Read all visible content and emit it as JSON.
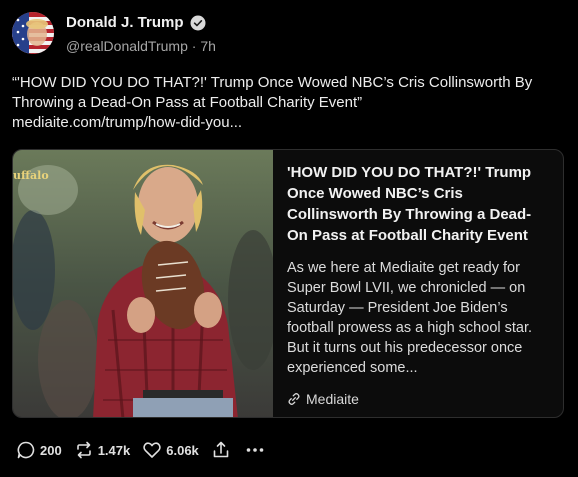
{
  "author": {
    "display_name": "Donald J. Trump",
    "handle": "@realDonaldTrump",
    "separator": "·",
    "timestamp": "7h",
    "avatar_icon": "flag-portrait-avatar",
    "verified_icon": "verified-badge-icon"
  },
  "post": {
    "text": "“'HOW DID YOU DO THAT?!' Trump Once Wowed NBC’s Cris Collinsworth By Throwing a Dead-On Pass at Football Charity Event”",
    "link": "mediaite.com/trump/how-did-you..."
  },
  "card": {
    "image_caption": "uffalo",
    "title": "'HOW DID YOU DO THAT?!' Trump Once Wowed NBC’s Cris Collinsworth By Throwing a Dead-On Pass at Football Charity Event",
    "description": "As we here at Mediaite get ready for Super Bowl LVII, we chronicled — on Saturday — President Joe Biden’s football prowess as a high school star. But it turns out his predecessor once experienced some...",
    "source": "Mediaite",
    "source_icon": "link-icon"
  },
  "actions": {
    "replies": "200",
    "reposts": "1.47k",
    "likes": "6.06k",
    "reply_icon": "reply-icon",
    "repost_icon": "repost-icon",
    "like_icon": "heart-icon",
    "share_icon": "share-icon",
    "more_icon": "more-icon"
  },
  "colors": {
    "background": "#000000",
    "text": "#ededed",
    "muted": "#a6a6a6",
    "card_border": "#2e2e2e"
  }
}
